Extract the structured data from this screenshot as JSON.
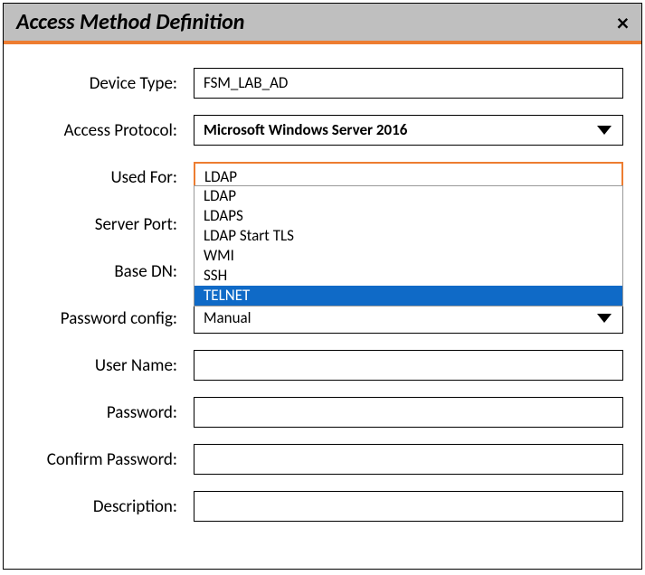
{
  "dialog": {
    "title": "Access Method Definition",
    "close_symbol": "×"
  },
  "labels": {
    "device_type": "Device Type:",
    "access_protocol": "Access Protocol:",
    "used_for": "Used For:",
    "server_port": "Server Port:",
    "base_dn": "Base DN:",
    "password_config": "Password config:",
    "user_name": "User Name:",
    "password": "Password:",
    "confirm_password": "Confirm Password:",
    "description": "Description:"
  },
  "values": {
    "device_type": "FSM_LAB_AD",
    "access_protocol": "Microsoft Windows Server 2016",
    "used_for": "LDAP",
    "server_port": "",
    "base_dn": "",
    "password_config": "Manual",
    "user_name": "",
    "password": "",
    "confirm_password": "",
    "description": ""
  },
  "used_for_options": {
    "0": "LDAP",
    "1": "LDAPS",
    "2": "LDAP Start TLS",
    "3": "WMI",
    "4": "SSH",
    "5": "TELNET"
  }
}
